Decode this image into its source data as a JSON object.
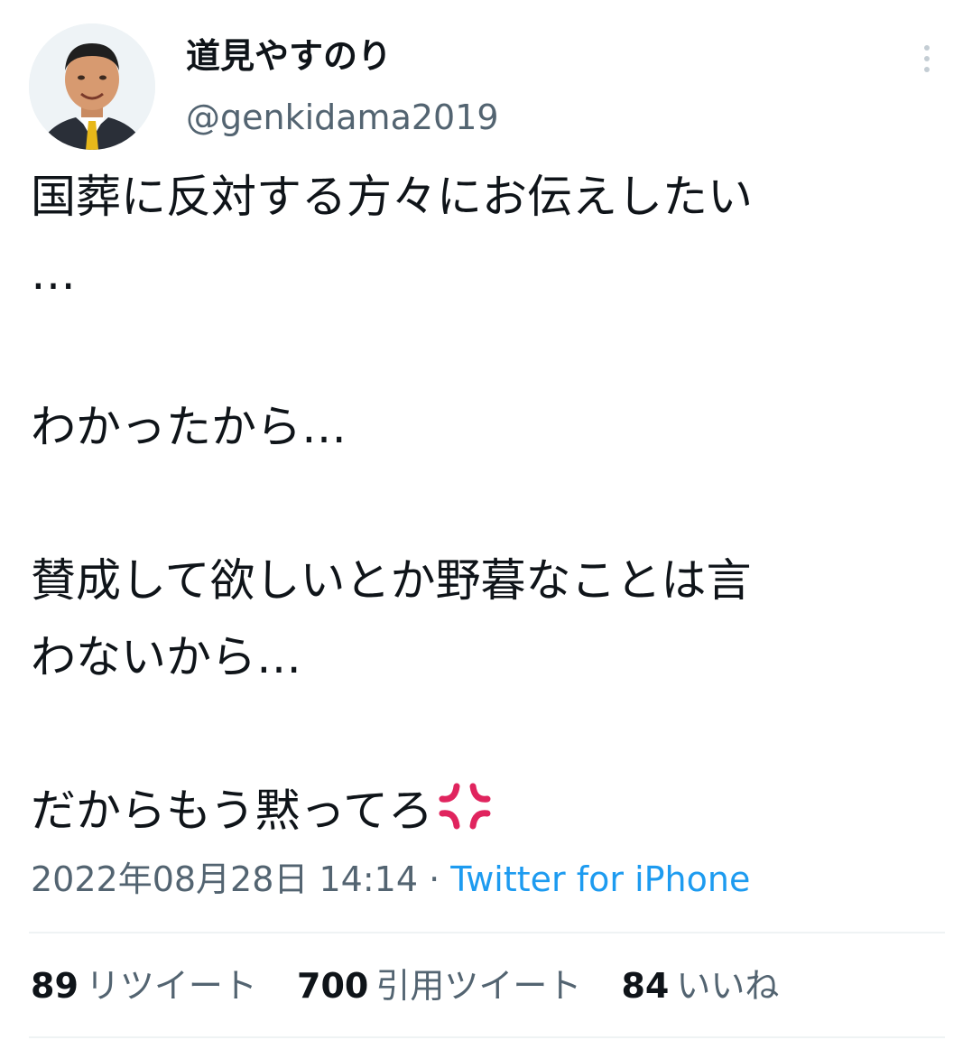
{
  "user": {
    "display_name": "道見やすのり",
    "handle": "@genkidama2019",
    "avatar_icon": "profile-photo"
  },
  "more_icon": "more-vertical-icon",
  "tweet": {
    "lines": [
      "国葬に反対する方々にお伝えしたい",
      "…",
      "",
      "わかったから…",
      "",
      "賛成して欲しいとか野暮なことは言",
      "わないから…",
      "",
      "だからもう黙ってろ"
    ],
    "trailing_emoji": "anger-symbol-icon",
    "timestamp": "2022年08月28日 14:14",
    "separator": "·",
    "source": "Twitter for iPhone"
  },
  "stats": {
    "retweets": {
      "count": "89",
      "label": "リツイート"
    },
    "quotes": {
      "count": "700",
      "label": "引用ツイート"
    },
    "likes": {
      "count": "84",
      "label": "いいね"
    }
  },
  "colors": {
    "text": "#0f1419",
    "secondary": "#536471",
    "link": "#1d9bf0",
    "divider": "#eff3f4",
    "anger": "#e0245e"
  }
}
